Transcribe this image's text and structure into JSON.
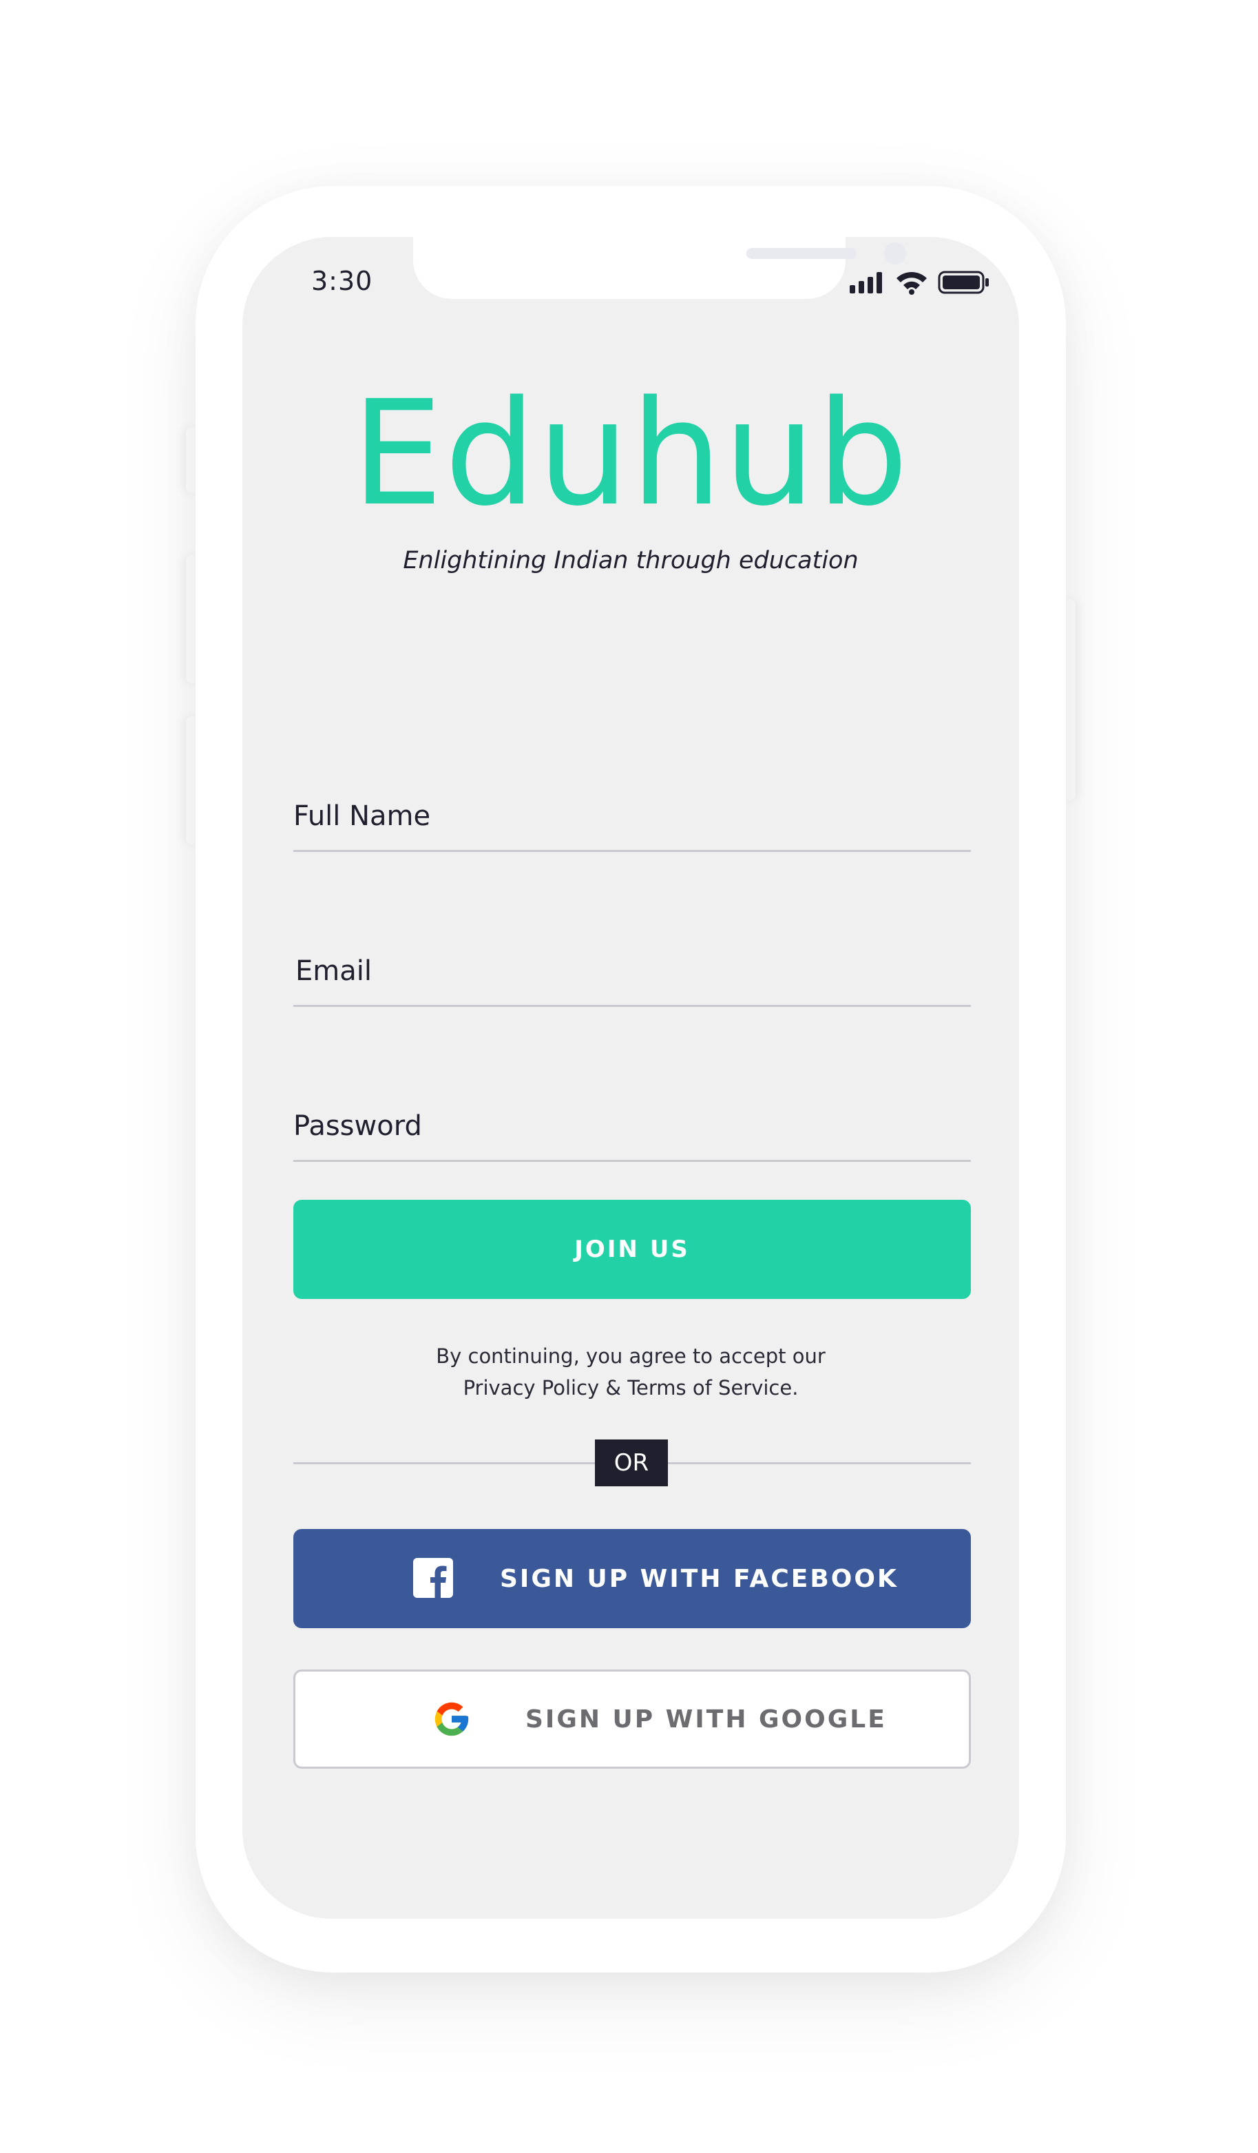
{
  "status_bar": {
    "time": "3:30",
    "icons": [
      "signal-icon",
      "wifi-icon",
      "battery-icon"
    ]
  },
  "brand": {
    "name": "Eduhub",
    "tagline": "Enlightining Indian through education",
    "color": "#22d1a6"
  },
  "form": {
    "full_name_label": "Full Name",
    "email_label": "Email",
    "password_label": "Password",
    "join_button": "JOIN US",
    "legal_line1": "By continuing, you agree to accept our",
    "legal_line2": "Privacy Policy & Terms of Service.",
    "divider": "OR"
  },
  "social": {
    "facebook_label": "SIGN UP WITH FACEBOOK",
    "facebook_color": "#3b5998",
    "google_label": "SIGN UP WITH GOOGLE"
  }
}
